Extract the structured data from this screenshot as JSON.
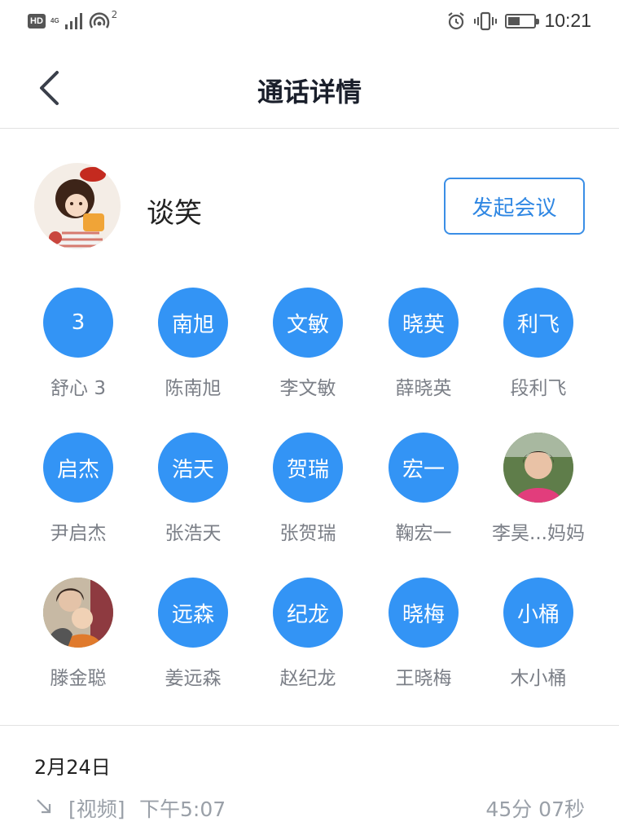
{
  "status_bar": {
    "hd": "HD",
    "net": "4G",
    "hotspot_count": "2",
    "time": "10:21",
    "battery_level": 0.45,
    "icons": [
      "hd-icon",
      "signal-icon",
      "hotspot-icon",
      "alarm-icon",
      "vibrate-icon",
      "battery-icon"
    ]
  },
  "header": {
    "title": "通话详情",
    "back_icon": "chevron-left-icon"
  },
  "contact": {
    "name": "谈笑",
    "meeting_button": "发起会议"
  },
  "members": [
    {
      "initials": "3",
      "name": "舒心 3"
    },
    {
      "initials": "南旭",
      "name": "陈南旭"
    },
    {
      "initials": "文敏",
      "name": "李文敏"
    },
    {
      "initials": "晓英",
      "name": "薛晓英"
    },
    {
      "initials": "利飞",
      "name": "段利飞"
    },
    {
      "initials": "启杰",
      "name": "尹启杰"
    },
    {
      "initials": "浩天",
      "name": "张浩天"
    },
    {
      "initials": "贺瑞",
      "name": "张贺瑞"
    },
    {
      "initials": "宏一",
      "name": "鞠宏一"
    },
    {
      "initials": "",
      "name": "李昊...妈妈",
      "photo": true
    },
    {
      "initials": "",
      "name": "滕金聪",
      "photo": true
    },
    {
      "initials": "远森",
      "name": "姜远森"
    },
    {
      "initials": "纪龙",
      "name": "赵纪龙"
    },
    {
      "initials": "晓梅",
      "name": "王晓梅"
    },
    {
      "initials": "小桶",
      "name": "木小桶"
    }
  ],
  "call_log": {
    "date": "2月24日",
    "type": "[视频]",
    "time": "下午5:07",
    "duration": "45分 07秒",
    "direction_icon": "incoming-arrow-icon"
  },
  "colors": {
    "accent": "#3394f5",
    "button_border": "#3a8ee6",
    "muted_text": "#9aa0a8",
    "member_name": "#7b7f87"
  }
}
